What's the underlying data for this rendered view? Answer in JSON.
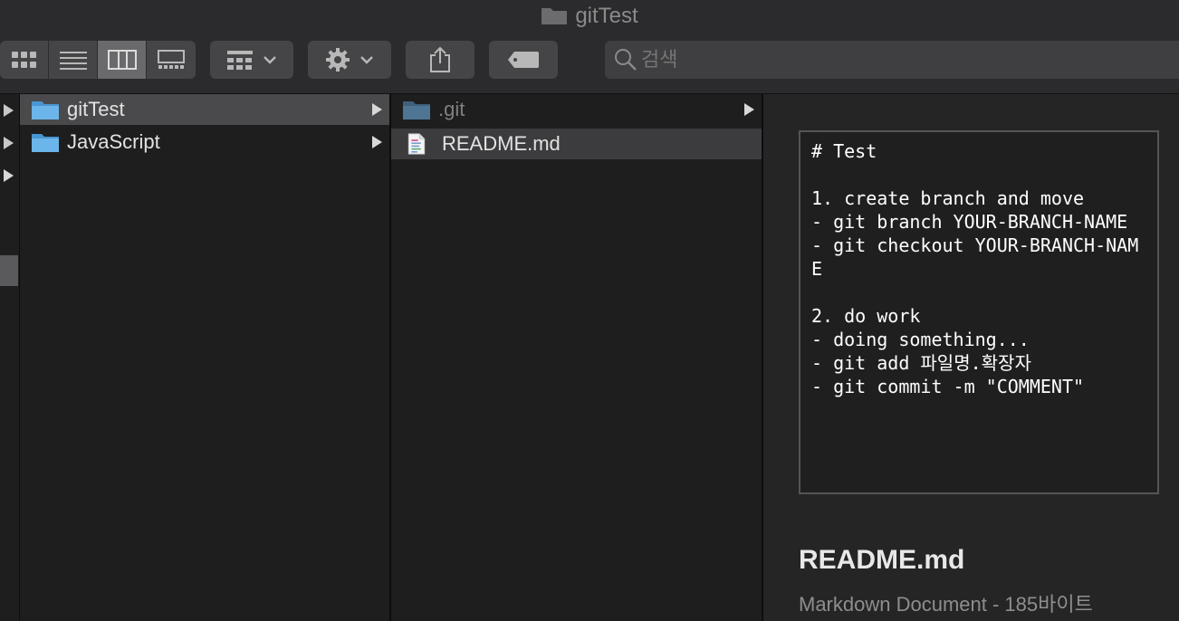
{
  "window": {
    "title": "gitTest"
  },
  "toolbar": {
    "view_buttons": [
      "icon-view",
      "list-view",
      "column-view",
      "gallery-view"
    ],
    "search_placeholder": "검색"
  },
  "columns": [
    {
      "items": [
        {
          "name": "gitTest",
          "kind": "folder",
          "selected": true
        },
        {
          "name": "JavaScript",
          "kind": "folder",
          "selected": false
        }
      ]
    },
    {
      "items": [
        {
          "name": ".git",
          "kind": "folder",
          "dim": true
        },
        {
          "name": "README.md",
          "kind": "file",
          "selected": true
        }
      ]
    }
  ],
  "preview": {
    "content": "# Test\n\n1. create branch and move\n- git branch YOUR-BRANCH-NAME\n- git checkout YOUR-BRANCH-NAME\n\n2. do work\n- doing something...\n- git add 파일명.확장자\n- git commit -m \"COMMENT\"",
    "file_name": "README.md",
    "file_info": "Markdown Document - 185바이트"
  },
  "colors": {
    "folder": "#5aa7e0",
    "background": "#1e1e1f",
    "toolbar": "#2b2b2d"
  }
}
